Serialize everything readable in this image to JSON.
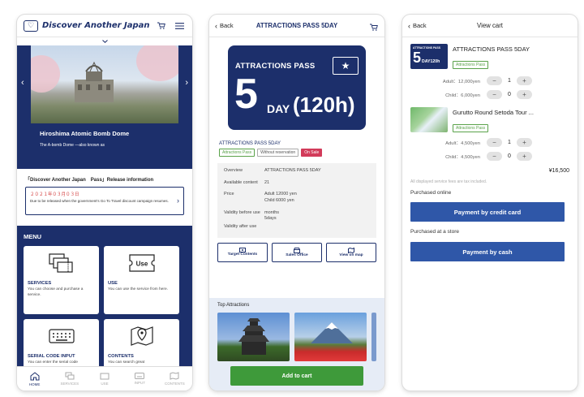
{
  "home": {
    "brand": "Discover Another Japan",
    "hero": {
      "title": "Hiroshima Atomic Bomb Dome",
      "subtitle": "The A-bomb Dome —also known as"
    },
    "release": {
      "title": "「Discover Another Japan　Pass」Release information",
      "date": "２０２１年０３月０３日",
      "description": "Due to be released when the government's Go To Travel discount campaign resumes."
    },
    "menu": {
      "title": "MENU",
      "cards": [
        {
          "title": "SERVICES",
          "desc": "You can choose and purchase a service.",
          "icon": "tickets-icon"
        },
        {
          "title": "USE",
          "desc": "You can use the service from here.",
          "icon": "ticket-use-icon",
          "icon_text": "Use"
        },
        {
          "title": "SERIAL CODE INPUT",
          "desc": "You can enter the serial code",
          "icon": "keyboard-icon"
        },
        {
          "title": "CONTENTS",
          "desc": "You can search great",
          "icon": "map-pin-icon"
        }
      ]
    },
    "nav": [
      "HOME",
      "SERVICES",
      "USE",
      "INPUT",
      "CONTENTS"
    ]
  },
  "detail": {
    "back": "Back",
    "title": "ATTRACTIONS PASS 5DAY",
    "card": {
      "label": "ATTRACTIONS PASS",
      "big": "5",
      "day": "DAY",
      "hours": "(120h)"
    },
    "product_name": "ATTRACTIONS PASS 5DAY",
    "tags": [
      "Attractions Pass",
      "Without reservation",
      "On Sale"
    ],
    "info": [
      {
        "key": "Overview",
        "value": "ATTRACTIONS PASS 5DAY"
      },
      {
        "key": "Available content",
        "value": "21"
      },
      {
        "key": "Price",
        "value": "Adult 12000 yen\nChild 6000 yen"
      },
      {
        "key": "Validity before use",
        "value": "months\n5days"
      },
      {
        "key": "Validity after use",
        "value": ""
      }
    ],
    "actions": [
      "Target Contents",
      "Sales Office",
      "View on map"
    ],
    "top_attractions_title": "Top Attractions",
    "add_to_cart": "Add to cart"
  },
  "cart": {
    "back": "Back",
    "title": "View cart",
    "items": [
      {
        "name": "ATTRACTIONS PASS 5DAY",
        "tag": "Attractions Pass",
        "thumb": {
          "label": "ATTRACTIONS PASS",
          "big": "5",
          "text": "DAY120h"
        },
        "rows": [
          {
            "label": "Adult：12,000yen",
            "qty": "1"
          },
          {
            "label": "Child：6,000yen",
            "qty": "0"
          }
        ]
      },
      {
        "name": "Gurutto Round Setoda Tour ...",
        "tag": "Attractions Pass",
        "rows": [
          {
            "label": "Adult：4,500yen",
            "qty": "1"
          },
          {
            "label": "Child：4,500yen",
            "qty": "0"
          }
        ]
      }
    ],
    "total": "¥16,500",
    "tax_note": "All displayed service fees are tax included.",
    "online_label": "Purchased online",
    "credit_button": "Payment by credit card",
    "store_label": "Purchased at a store",
    "cash_button": "Payment by cash"
  },
  "colors": {
    "navy": "#1c2f6b",
    "green": "#3e9a3a",
    "blue_button": "#2f57a8",
    "sale_red": "#d23b5a"
  }
}
